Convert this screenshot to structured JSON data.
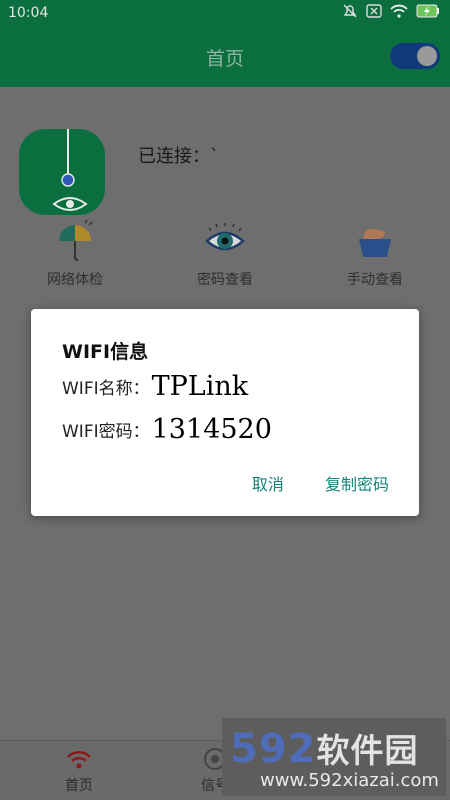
{
  "status_bar": {
    "time": "10:04",
    "icons": [
      "mute-icon",
      "close-box-icon",
      "wifi-icon",
      "battery-charging-icon"
    ]
  },
  "app_bar": {
    "title": "首页",
    "toggle_on": true
  },
  "header": {
    "connected_label": "已连接：`",
    "app_icon": "eye-pendulum-icon"
  },
  "quick_actions": [
    {
      "label": "网络体检",
      "icon": "umbrella-icon"
    },
    {
      "label": "密码查看",
      "icon": "eye-icon"
    },
    {
      "label": "手动查看",
      "icon": "hand-icon"
    }
  ],
  "bottom_nav": {
    "items": [
      {
        "label": "首页",
        "icon": "wifi-signal-icon"
      },
      {
        "label": "信号",
        "icon": "radar-icon"
      }
    ]
  },
  "watermark": {
    "brand_digits": "592",
    "brand_text": "软件园",
    "url": "www.592xiazai.com"
  },
  "dialog": {
    "title": "WIFI信息",
    "name_label": "WIFI名称：",
    "name_value": "TPLink",
    "password_label": "WIFI密码：",
    "password_value": "1314520",
    "cancel_label": "取消",
    "copy_label": "复制密码"
  },
  "colors": {
    "primary_green": "#0a6e3f",
    "dialog_button": "#12847a",
    "toggle_track": "#123a7a"
  }
}
